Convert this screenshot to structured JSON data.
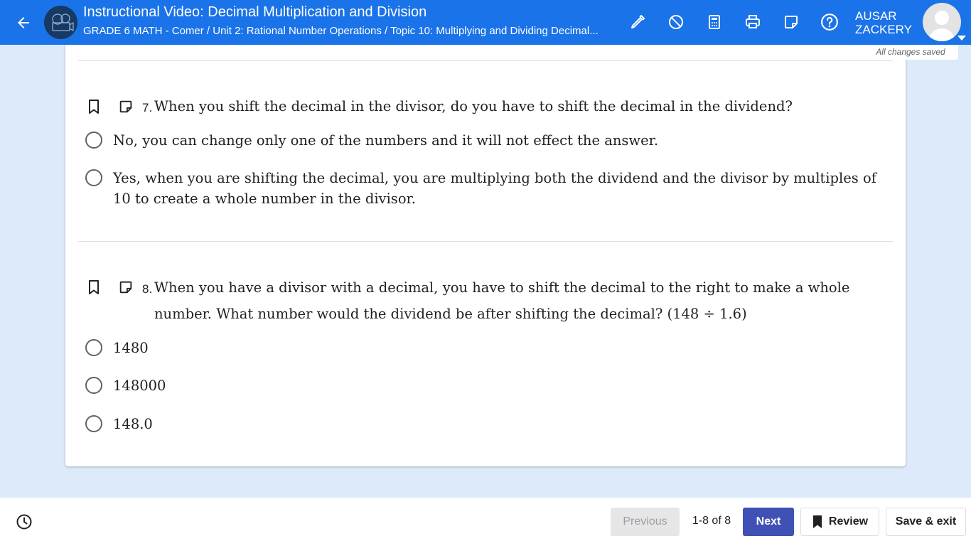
{
  "header": {
    "title": "Instructional Video: Decimal Multiplication and Division",
    "breadcrumb": "GRADE 6 MATH - Comer / Unit 2: Rational Number Operations / Topic 10: Multiplying and Dividing Decimal...",
    "user_first": "AUSAR",
    "user_last": "ZACKERY",
    "colors": {
      "bar": "#1a73e8",
      "logo_bg": "#163a63"
    },
    "tools": [
      "highlighter-icon",
      "eliminator-icon",
      "calculator-icon",
      "print-icon",
      "notepad-icon",
      "help-icon"
    ]
  },
  "status": {
    "saved": "All changes saved"
  },
  "questions": [
    {
      "number": "7.",
      "text": "When you shift the decimal in the divisor, do you have to shift the decimal in the dividend?",
      "options": [
        "No, you can change only one of the numbers and it will not effect the answer.",
        "Yes, when you are shifting the decimal, you are multiplying both the dividend and the divisor by multiples of 10 to create a whole number in the divisor."
      ]
    },
    {
      "number": "8.",
      "text": "When you have a divisor with a decimal, you have to shift the decimal to the right to make a whole number. What number would the dividend be after shifting the decimal? (148 ÷ 1.6)",
      "options": [
        "1480",
        "148000",
        "148.0"
      ]
    }
  ],
  "footer": {
    "previous": "Previous",
    "count": "1-8 of 8",
    "next": "Next",
    "review": "Review",
    "save_exit": "Save & exit",
    "colors": {
      "next": "#3f51b5",
      "previous_bg": "#e6e6e6"
    }
  }
}
